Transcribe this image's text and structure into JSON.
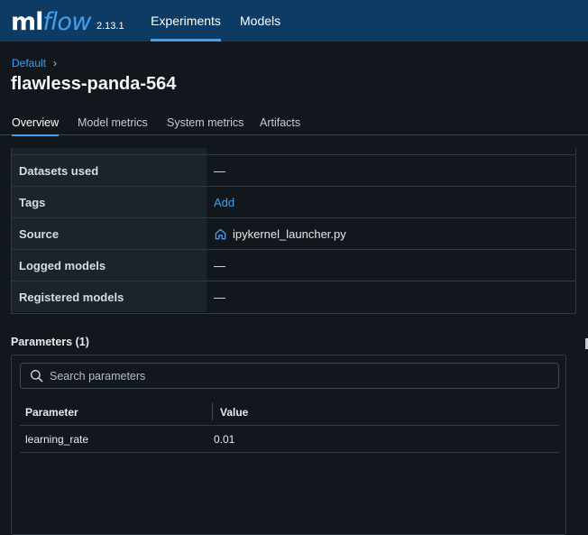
{
  "topbar": {
    "logo_ml": "ml",
    "logo_flow": "flow",
    "version": "2.13.1",
    "nav": [
      {
        "label": "Experiments",
        "active": true
      },
      {
        "label": "Models",
        "active": false
      }
    ]
  },
  "breadcrumb": {
    "label": "Default",
    "separator": "›"
  },
  "page_title": "flawless-panda-564",
  "subtabs": [
    {
      "label": "Overview",
      "active": true
    },
    {
      "label": "Model metrics",
      "active": false
    },
    {
      "label": "System metrics",
      "active": false
    },
    {
      "label": "Artifacts",
      "active": false
    }
  ],
  "details": [
    {
      "label": "Datasets used",
      "value": "—",
      "link": false
    },
    {
      "label": "Tags",
      "value": "Add",
      "link": true
    },
    {
      "label": "Source",
      "value": "ipykernel_launcher.py",
      "link": false,
      "icon": "home-icon"
    },
    {
      "label": "Logged models",
      "value": "—",
      "link": false
    },
    {
      "label": "Registered models",
      "value": "—",
      "link": false
    }
  ],
  "parameters": {
    "title": "Parameters (1)",
    "search_placeholder": "Search parameters",
    "columns": [
      "Parameter",
      "Value"
    ],
    "rows": [
      {
        "parameter": "learning_rate",
        "value": "0.01"
      }
    ]
  },
  "colors": {
    "topbar_bg": "#0e3b63",
    "accent": "#43a0ee",
    "page_bg": "#11171c"
  }
}
